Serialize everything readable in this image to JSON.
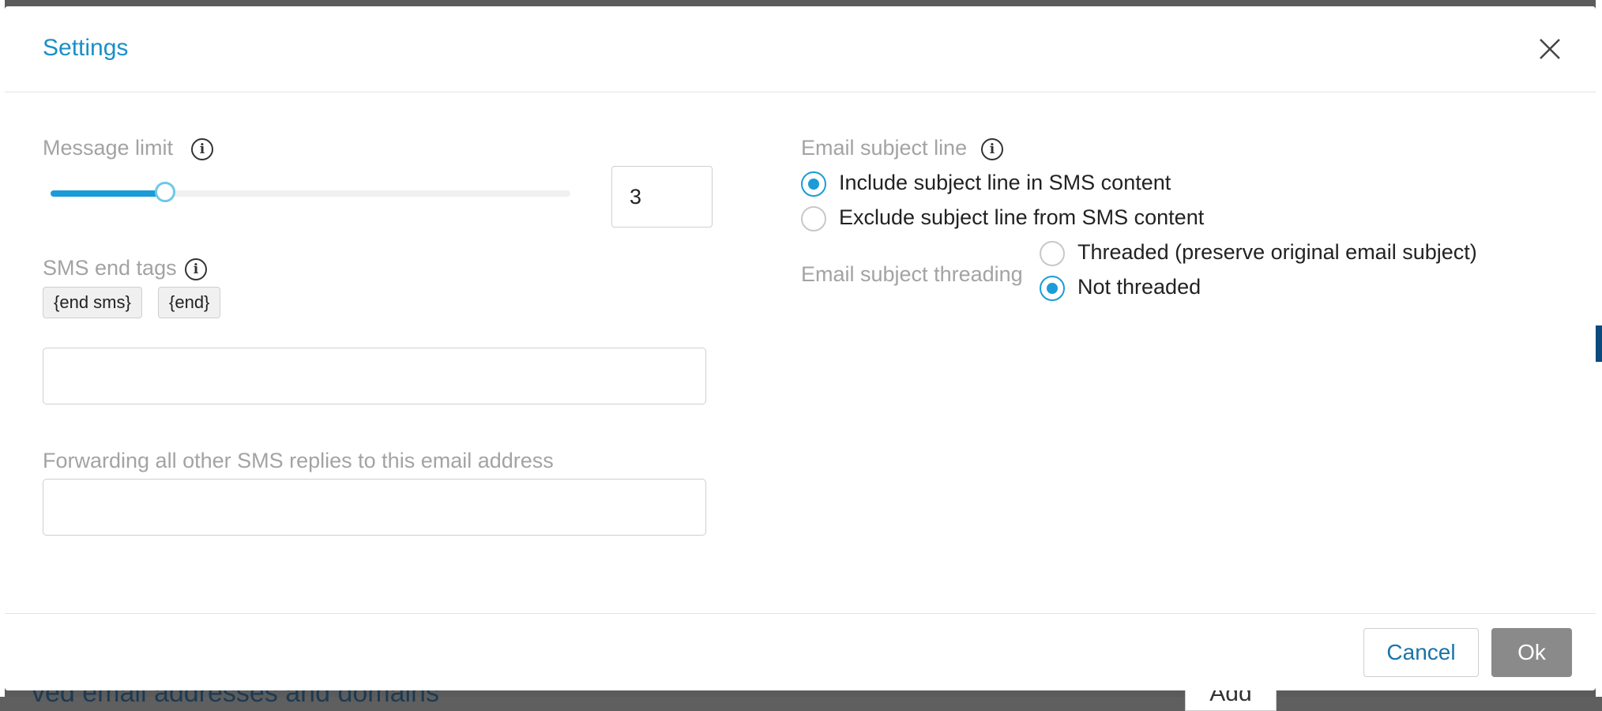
{
  "background": {
    "peek_text": "ved email addresses and domains",
    "peek_button": "Add"
  },
  "modal": {
    "title": "Settings",
    "close_icon": "close-icon",
    "accent_color": "#1a9cd8"
  },
  "message_limit": {
    "label": "Message limit",
    "value": "3",
    "slider_fraction": 0.22
  },
  "sms_end_tags": {
    "label": "SMS end tags",
    "tags": [
      "{end sms}",
      "{end}"
    ],
    "input_value": ""
  },
  "forwarding": {
    "label": "Forwarding all other SMS replies to this email address",
    "input_value": ""
  },
  "email_subject_line": {
    "label": "Email subject line",
    "options": [
      {
        "label": "Include subject line in SMS content",
        "checked": true
      },
      {
        "label": "Exclude subject line from SMS content",
        "checked": false
      }
    ]
  },
  "email_subject_threading": {
    "label": "Email subject threading",
    "options": [
      {
        "label": "Threaded (preserve original email subject)",
        "checked": false
      },
      {
        "label": "Not threaded",
        "checked": true
      }
    ]
  },
  "footer": {
    "cancel_label": "Cancel",
    "ok_label": "Ok"
  }
}
